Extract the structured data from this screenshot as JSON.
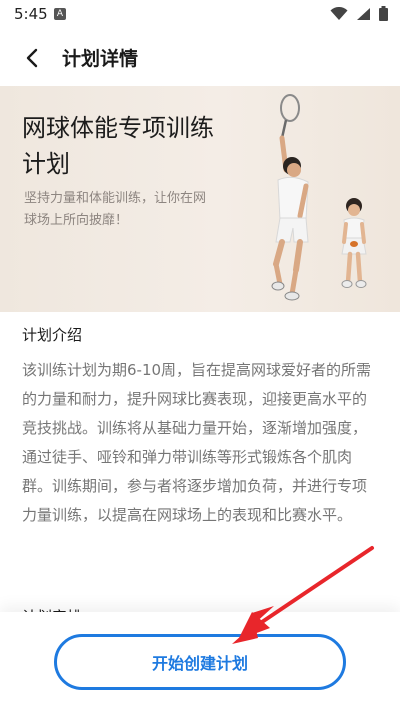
{
  "status_bar": {
    "time": "5:45",
    "notification_letter": "A",
    "icons": [
      "wifi-icon",
      "cellular-icon",
      "battery-icon"
    ]
  },
  "header": {
    "back_icon": "chevron-left-icon",
    "title": "计划详情"
  },
  "hero": {
    "title": "网球体能专项训练计划",
    "subtitle": "坚持力量和体能训练，让你在网球场上所向披靡！"
  },
  "intro": {
    "title": "计划介绍",
    "body": "该训练计划为期6-10周，旨在提高网球爱好者的所需的力量和耐力，提升网球比赛表现，迎接更高水平的竞技挑战。训练将从基础力量开始，逐渐增加强度，通过徒手、哑铃和弹力带训练等形式锻炼各个肌肉群。训练期间，参与者将逐步增加负荷，并进行专项力量训练，以提高在网球场上的表现和比赛水平。"
  },
  "next_section": {
    "title": "计划安排"
  },
  "cta": {
    "label": "开始创建计划"
  },
  "colors": {
    "accent": "#1e7ae0",
    "annotation": "#e8262b",
    "hero_bg": "#f1e9e1"
  }
}
